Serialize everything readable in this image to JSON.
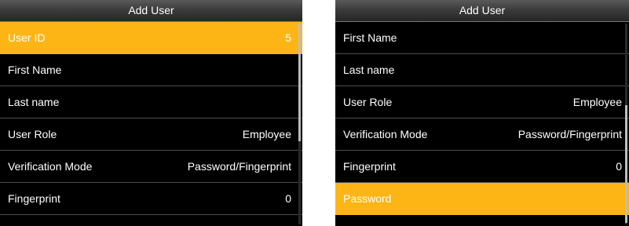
{
  "left_screen": {
    "title": "Add User",
    "rows": [
      {
        "label": "User ID",
        "value": "5"
      },
      {
        "label": "First Name",
        "value": ""
      },
      {
        "label": "Last name",
        "value": ""
      },
      {
        "label": "User Role",
        "value": "Employee"
      },
      {
        "label": "Verification Mode",
        "value": "Password/Fingerprint"
      },
      {
        "label": "Fingerprint",
        "value": "0"
      }
    ]
  },
  "right_screen": {
    "title": "Add User",
    "rows": [
      {
        "label": "First Name",
        "value": ""
      },
      {
        "label": "Last name",
        "value": ""
      },
      {
        "label": "User Role",
        "value": "Employee"
      },
      {
        "label": "Verification Mode",
        "value": "Password/Fingerprint"
      },
      {
        "label": "Fingerprint",
        "value": "0"
      },
      {
        "label": "Password",
        "value": ""
      }
    ]
  },
  "colors": {
    "highlight": "#fcb514",
    "background": "#000000",
    "text": "#ffffff"
  }
}
